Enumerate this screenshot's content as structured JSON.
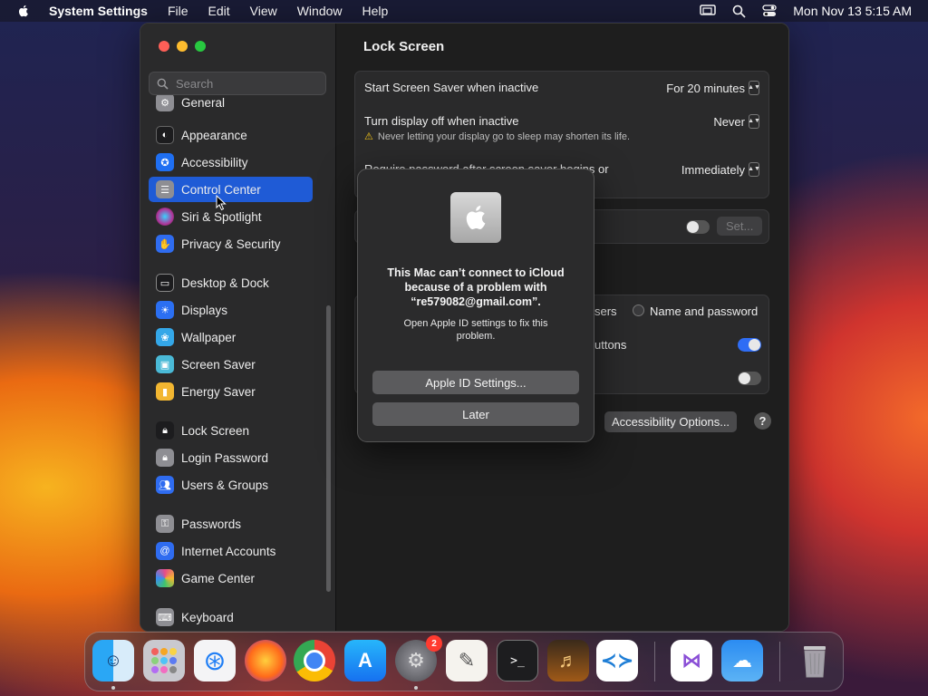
{
  "menubar": {
    "app_name": "System Settings",
    "menus": [
      "File",
      "Edit",
      "View",
      "Window",
      "Help"
    ],
    "datetime": "Mon Nov 13  5:15 AM"
  },
  "sidebar": {
    "search_placeholder": "Search",
    "items": [
      {
        "label": "General",
        "icon": "gear-icon",
        "color": "#8e8e93"
      },
      {
        "label": "Appearance",
        "icon": "appearance-icon",
        "color": "#1c1c1e"
      },
      {
        "label": "Accessibility",
        "icon": "accessibility-icon",
        "color": "#1f6ff2"
      },
      {
        "label": "Control Center",
        "icon": "control-center-icon",
        "color": "#8e8e93",
        "active": true
      },
      {
        "label": "Siri & Spotlight",
        "icon": "siri-icon",
        "color": "#b0369a"
      },
      {
        "label": "Privacy & Security",
        "icon": "hand-icon",
        "color": "#2f6cf0"
      },
      {
        "label": "Desktop & Dock",
        "icon": "dock-icon",
        "color": "#1c1c1e"
      },
      {
        "label": "Displays",
        "icon": "sun-icon",
        "color": "#2b6ff2"
      },
      {
        "label": "Wallpaper",
        "icon": "wallpaper-icon",
        "color": "#34a7e8"
      },
      {
        "label": "Screen Saver",
        "icon": "screensaver-icon",
        "color": "#4ab9d6"
      },
      {
        "label": "Energy Saver",
        "icon": "battery-icon",
        "color": "#f2b631"
      },
      {
        "label": "Lock Screen",
        "icon": "lock-icon",
        "color": "#1c1c1e"
      },
      {
        "label": "Login Password",
        "icon": "lock-icon",
        "color": "#8e8e93"
      },
      {
        "label": "Users & Groups",
        "icon": "users-icon",
        "color": "#2f6cf0"
      },
      {
        "label": "Passwords",
        "icon": "key-icon",
        "color": "#8e8e93"
      },
      {
        "label": "Internet Accounts",
        "icon": "at-icon",
        "color": "#2f6cf0"
      },
      {
        "label": "Game Center",
        "icon": "game-center-icon",
        "color": "#e84b8a"
      },
      {
        "label": "Keyboard",
        "icon": "keyboard-icon",
        "color": "#8e8e93"
      }
    ]
  },
  "content": {
    "title": "Lock Screen",
    "rows": {
      "screensaver_label": "Start Screen Saver when inactive",
      "screensaver_value": "For 20 minutes",
      "display_off_label": "Turn display off when inactive",
      "display_off_value": "Never",
      "display_off_warning": "Never letting your display go to sleep may shorten its life.",
      "require_password_label": "Require password after screen saver begins or",
      "require_password_value": "Immediately",
      "set_button": "Set...",
      "users_partial": "sers",
      "name_and_password": "Name and password",
      "buttons_partial": "uttons",
      "accessibility_options": "Accessibility Options...",
      "help": "?"
    }
  },
  "alert": {
    "title": "This Mac can’t connect to iCloud because of a problem with “re579082@gmail.com”.",
    "message": "Open Apple ID settings to fix this problem.",
    "primary_button": "Apple ID Settings...",
    "secondary_button": "Later"
  },
  "dock": {
    "settings_badge": "2",
    "apps": [
      "finder-icon",
      "launchpad-icon",
      "safari-icon",
      "firefox-icon",
      "chrome-icon",
      "app-store-icon",
      "system-settings-icon",
      "textedit-icon",
      "terminal-icon",
      "garageband-icon",
      "vscode-icon",
      "visual-studio-icon",
      "weather-icon",
      "trash-icon"
    ]
  }
}
